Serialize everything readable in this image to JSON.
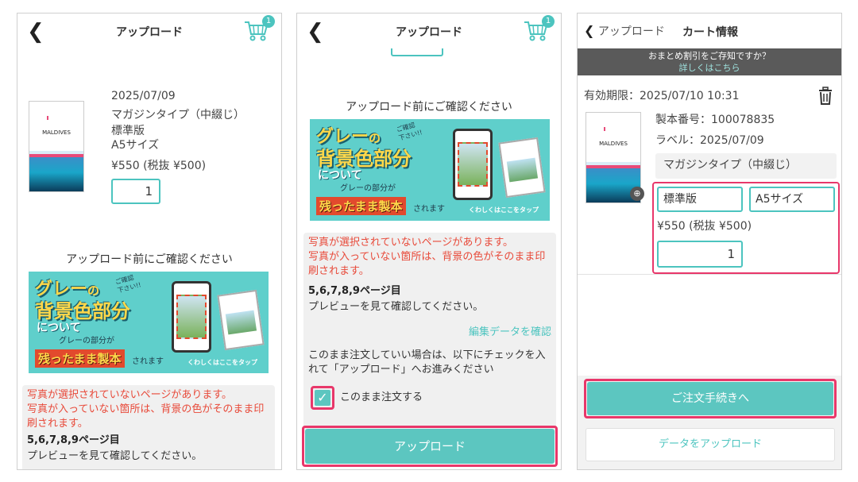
{
  "colors": {
    "accent": "#5cc6c0",
    "highlight": "#e8376a",
    "notice_red": "#e84a3a"
  },
  "screen1": {
    "title": "アップロード",
    "cart_badge": "1",
    "date": "2025/07/09",
    "product_type": "マガジンタイプ（中綴じ）",
    "edition": "標準版",
    "size": "A5サイズ",
    "price": "¥550 (税抜 ¥500)",
    "quantity": "1",
    "thumb_label": "MALDIVES",
    "confirm_heading": "アップロード前にご確認ください",
    "banner": {
      "line1a": "グレー",
      "line1b": "の",
      "line2": "背景色部分",
      "line3": "について",
      "line4": "グレーの部分が",
      "line5": "残ったまま製本",
      "line5b": "されます",
      "bubble": "ご確認\n下さい!!",
      "tap": "くわしくはここをタップ"
    },
    "warning1": "写真が選択されていないページがあります。",
    "warning2": "写真が入っていない箇所は、背景の色がそのまま印刷されます。",
    "pages": "5,6,7,8,9ページ目",
    "preview_note": "プレビューを見て確認してください。"
  },
  "screen2": {
    "title": "アップロード",
    "cart_badge": "1",
    "confirm_heading": "アップロード前にご確認ください",
    "banner": {
      "line1a": "グレー",
      "line1b": "の",
      "line2": "背景色部分",
      "line3": "について",
      "line4": "グレーの部分が",
      "line5": "残ったまま製本",
      "line5b": "されます",
      "bubble": "ご確認\n下さい!!",
      "tap": "くわしくはここをタップ"
    },
    "warning1": "写真が選択されていないページがあります。",
    "warning2": "写真が入っていない箇所は、背景の色がそのまま印刷されます。",
    "pages": "5,6,7,8,9ページ目",
    "preview_note": "プレビューを見て確認してください。",
    "edit_link": "編集データを確認",
    "instruction": "このまま注文していい場合は、以下にチェックを入れて「アップロード」へお進みください",
    "checkbox_label": "このまま注文する",
    "upload_button": "アップロード"
  },
  "screen3": {
    "back_label": "アップロード",
    "title": "カート情報",
    "info_line1": "おまとめ割引をご存知ですか？",
    "info_link": "詳しくはこちら",
    "expiry": "有効期限：2025/07/10 10:31",
    "product_no": "製本番号：100078835",
    "label": "ラベル：2025/07/09",
    "product_type": "マガジンタイプ（中綴じ）",
    "edition": "標準版",
    "size": "A5サイズ",
    "price": "¥550 (税抜 ¥500)",
    "quantity": "1",
    "thumb_label": "MALDIVES",
    "order_button": "ご注文手続きへ",
    "upload_button": "データをアップロード"
  }
}
